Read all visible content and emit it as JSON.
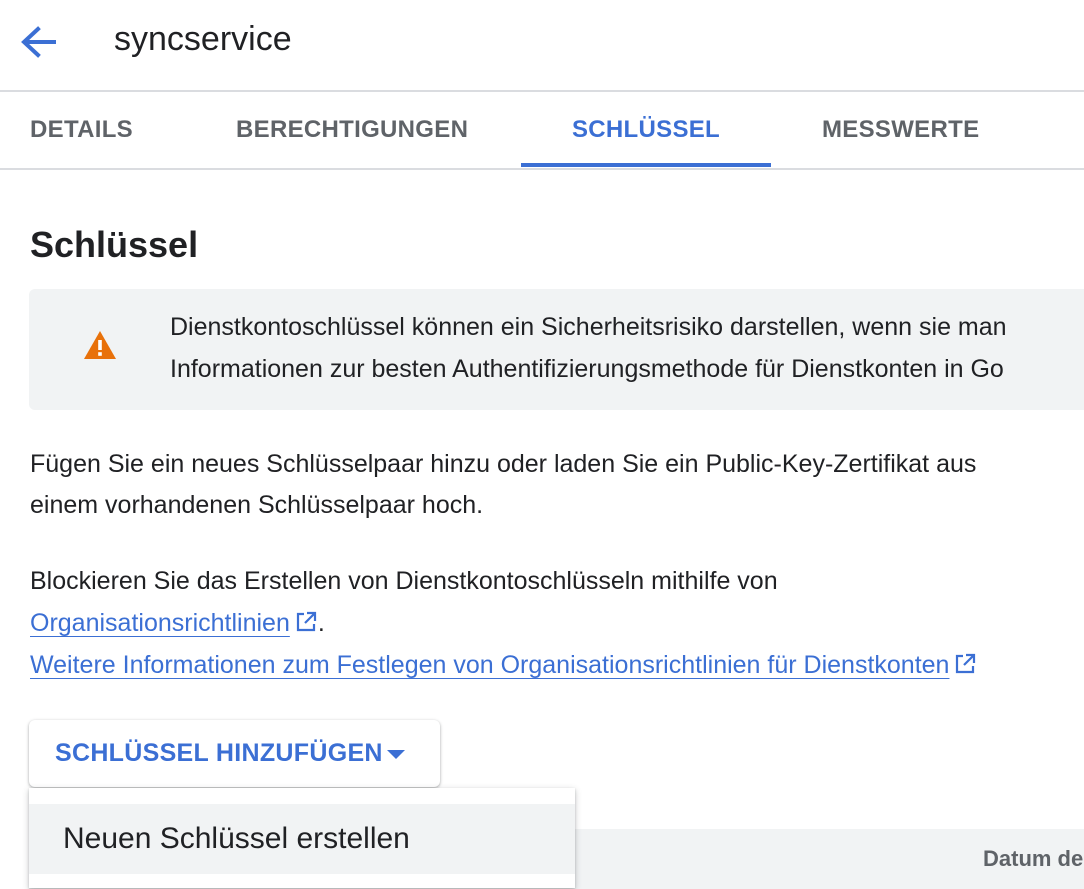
{
  "header": {
    "title": "syncservice",
    "back_icon": "arrow-back-icon"
  },
  "tabs": [
    {
      "label": "DETAILS",
      "active": false
    },
    {
      "label": "BERECHTIGUNGEN",
      "active": false
    },
    {
      "label": "SCHLÜSSEL",
      "active": true
    },
    {
      "label": "MESSWERTE",
      "active": false
    }
  ],
  "main": {
    "heading": "Schlüssel",
    "warning": {
      "icon": "warning-icon",
      "line1": "Dienstkontoschlüssel können ein Sicherheitsrisiko darstellen, wenn sie man",
      "line2": "Informationen zur besten Authentifizierungsmethode für Dienstkonten in Go"
    },
    "intro_line1": "Fügen Sie ein neues Schlüsselpaar hinzu oder laden Sie ein Public-Key-Zertifikat aus",
    "intro_line2": "einem vorhandenen Schlüsselpaar hoch.",
    "block_text": "Blockieren Sie das Erstellen von Dienstkontoschlüsseln mithilfe von",
    "policy_link": "Organisationsrichtlinien",
    "policy_link_suffix": ".",
    "more_info_link": "Weitere Informationen zum Festlegen von Organisationsrichtlinien für Dienstkonten",
    "external_icon": "open-in-new-icon",
    "add_key_button": "SCHLÜSSEL HINZUFÜGEN",
    "dropdown_icon": "arrow-drop-down-icon",
    "menu": {
      "items": [
        {
          "label": "Neuen Schlüssel erstellen"
        }
      ]
    },
    "table": {
      "columns": [
        "Datum de"
      ]
    }
  },
  "colors": {
    "accent": "#3b6fd4",
    "warning": "#e8710a",
    "surface": "#f1f3f4",
    "divider": "#dadce0"
  }
}
